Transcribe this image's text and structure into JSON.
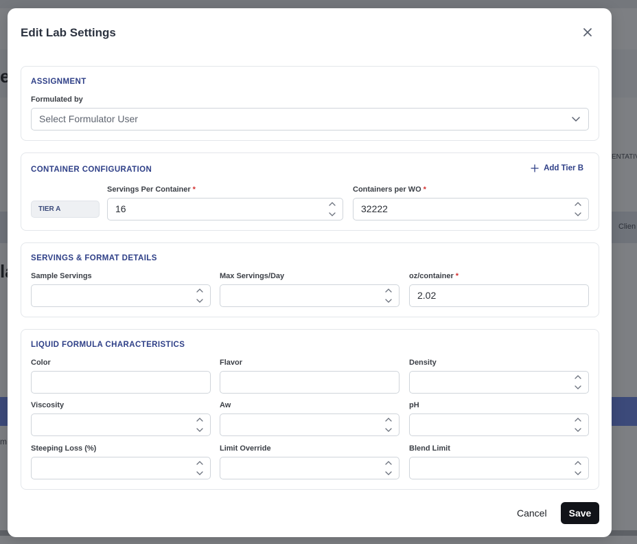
{
  "modal": {
    "title": "Edit Lab Settings",
    "close_icon": "close-icon"
  },
  "assignment": {
    "title": "ASSIGNMENT",
    "formulated_by_label": "Formulated by",
    "formulated_by_placeholder": "Select Formulator User"
  },
  "container": {
    "title": "CONTAINER CONFIGURATION",
    "add_tier_label": "Add Tier B",
    "tier_label": "TIER A",
    "servings_per_container_label": "Servings Per Container",
    "servings_per_container_value": "16",
    "containers_per_wo_label": "Containers per WO",
    "containers_per_wo_value": "32222",
    "required_mark": "*"
  },
  "servings": {
    "title": "SERVINGS & FORMAT DETAILS",
    "sample_servings_label": "Sample Servings",
    "sample_servings_value": "",
    "max_servings_label": "Max Servings/Day",
    "max_servings_value": "",
    "oz_container_label": "oz/container",
    "oz_container_value": "2.02"
  },
  "liquid": {
    "title": "LIQUID FORMULA CHARACTERISTICS",
    "color_label": "Color",
    "flavor_label": "Flavor",
    "density_label": "Density",
    "viscosity_label": "Viscosity",
    "aw_label": "Aw",
    "ph_label": "pH",
    "steeping_loss_label": "Steeping Loss (%)",
    "limit_override_label": "Limit Override",
    "blend_limit_label": "Blend Limit"
  },
  "footer": {
    "cancel_label": "Cancel",
    "save_label": "Save"
  },
  "background": {
    "frag_1": "e",
    "frag_2": "la",
    "frag_3": "ENTATIV",
    "frag_4": "Clien",
    "frag_5": "m"
  },
  "colors": {
    "section_title": "#2e3f87",
    "required": "#d32f2f",
    "save_bg": "#111318"
  }
}
